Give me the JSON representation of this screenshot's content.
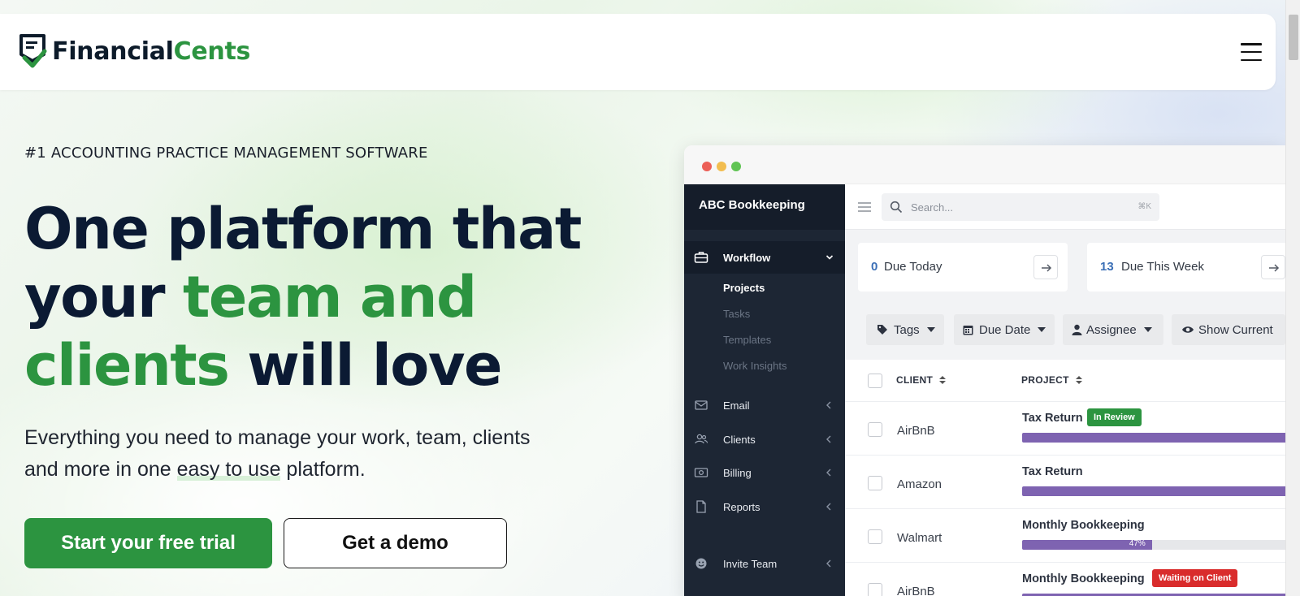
{
  "brand": {
    "name_part1": "Financial",
    "name_part2": "Cents",
    "color_dark": "#0d1b2a",
    "color_green": "#2c9440"
  },
  "header": {
    "menu_icon": "hamburger-menu-icon"
  },
  "hero": {
    "eyebrow": "#1 ACCOUNTING PRACTICE MANAGEMENT SOFTWARE",
    "headline": {
      "line1": "One platform that",
      "line2_a": "your ",
      "line2_b": "team and",
      "line3_a": "clients",
      "line3_b": " will love"
    },
    "subtext": {
      "part1": "Everything you need to manage your work, team, clients",
      "part2": "and more in one ",
      "part3": "easy to use",
      "part4": " platform."
    },
    "cta_primary": "Start your free trial",
    "cta_secondary": "Get a demo"
  },
  "app": {
    "org_name": "ABC Bookkeeping",
    "sidebar": {
      "workflow": {
        "label": "Workflow",
        "icon": "briefcase-icon"
      },
      "workflow_sub": [
        "Projects",
        "Tasks",
        "Templates",
        "Work Insights"
      ],
      "items": [
        {
          "label": "Email",
          "icon": "envelope-icon"
        },
        {
          "label": "Clients",
          "icon": "users-icon"
        },
        {
          "label": "Billing",
          "icon": "money-icon"
        },
        {
          "label": "Reports",
          "icon": "file-icon"
        },
        {
          "label": "Invite Team",
          "icon": "smile-icon"
        }
      ]
    },
    "search": {
      "placeholder": "Search...",
      "shortcut": "⌘K"
    },
    "cards": [
      {
        "count": "0",
        "label": "Due Today"
      },
      {
        "count": "13",
        "label": "Due This Week"
      }
    ],
    "filters": [
      "Tags",
      "Due Date",
      "Assignee",
      "Show Current"
    ],
    "table": {
      "columns": [
        "CLIENT",
        "PROJECT"
      ],
      "rows": [
        {
          "client": "AirBnB",
          "project": "Tax Return",
          "badge": "In Review",
          "progress": 100
        },
        {
          "client": "Amazon",
          "project": "Tax Return",
          "badge": "",
          "progress": 100
        },
        {
          "client": "Walmart",
          "project": "Monthly Bookkeeping",
          "badge": "",
          "progress": 47,
          "progress_label": "47%"
        },
        {
          "client": "AirBnB",
          "project": "Monthly Bookkeeping",
          "badge": "Waiting on Client",
          "progress": 100
        }
      ]
    }
  }
}
